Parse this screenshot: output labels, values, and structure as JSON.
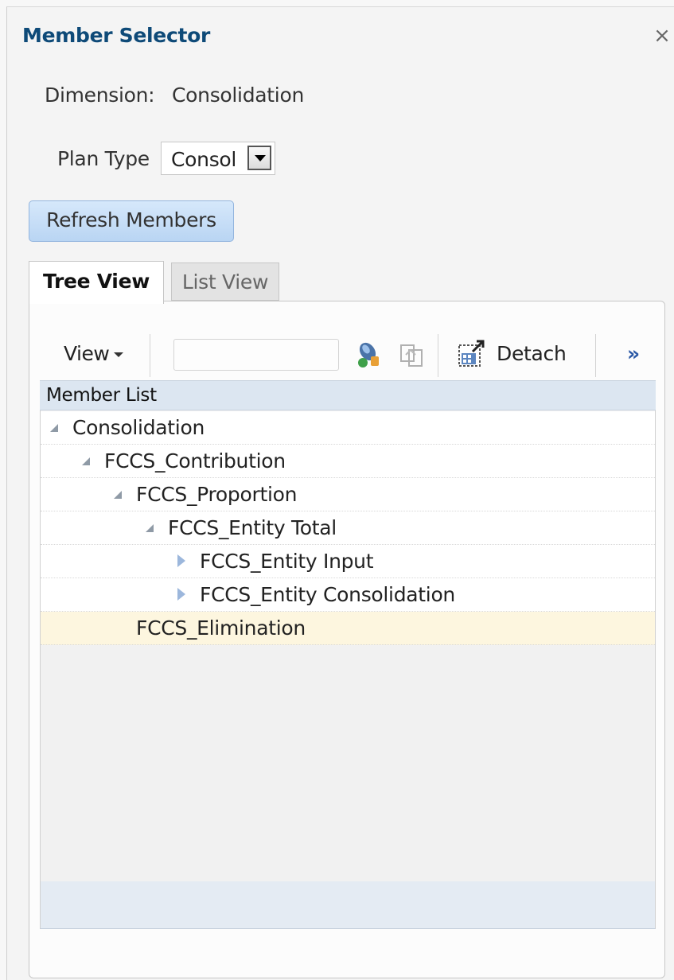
{
  "dialog": {
    "title": "Member Selector",
    "close_symbol": "×"
  },
  "dimension": {
    "label": "Dimension:",
    "value": "Consolidation"
  },
  "plan_type": {
    "label": "Plan Type",
    "selected": "Consol"
  },
  "refresh_button": {
    "label": "Refresh Members"
  },
  "tabs": [
    {
      "label": "Tree View",
      "active": true
    },
    {
      "label": "List View",
      "active": false
    }
  ],
  "toolbar": {
    "view_label": "View",
    "search_value": "",
    "detach_label": "Detach",
    "more_symbol": "»",
    "icons": [
      "find-member-icon",
      "refresh-icon",
      "detach-icon"
    ]
  },
  "member_list": {
    "header": "Member List",
    "rows": [
      {
        "label": "Consolidation",
        "level": 0,
        "state": "expanded"
      },
      {
        "label": "FCCS_Contribution",
        "level": 1,
        "state": "expanded"
      },
      {
        "label": "FCCS_Proportion",
        "level": 2,
        "state": "expanded"
      },
      {
        "label": "FCCS_Entity Total",
        "level": 3,
        "state": "expanded"
      },
      {
        "label": "FCCS_Entity Input",
        "level": 4,
        "state": "collapsed"
      },
      {
        "label": "FCCS_Entity Consolidation",
        "level": 4,
        "state": "collapsed"
      },
      {
        "label": "FCCS_Elimination",
        "level": 2,
        "state": "leaf",
        "selected": true
      }
    ]
  },
  "colors": {
    "title": "#0e4a78",
    "header_bg": "#dce6f1",
    "selected_row": "#fdf6df",
    "button_bg": "#c8def7"
  }
}
